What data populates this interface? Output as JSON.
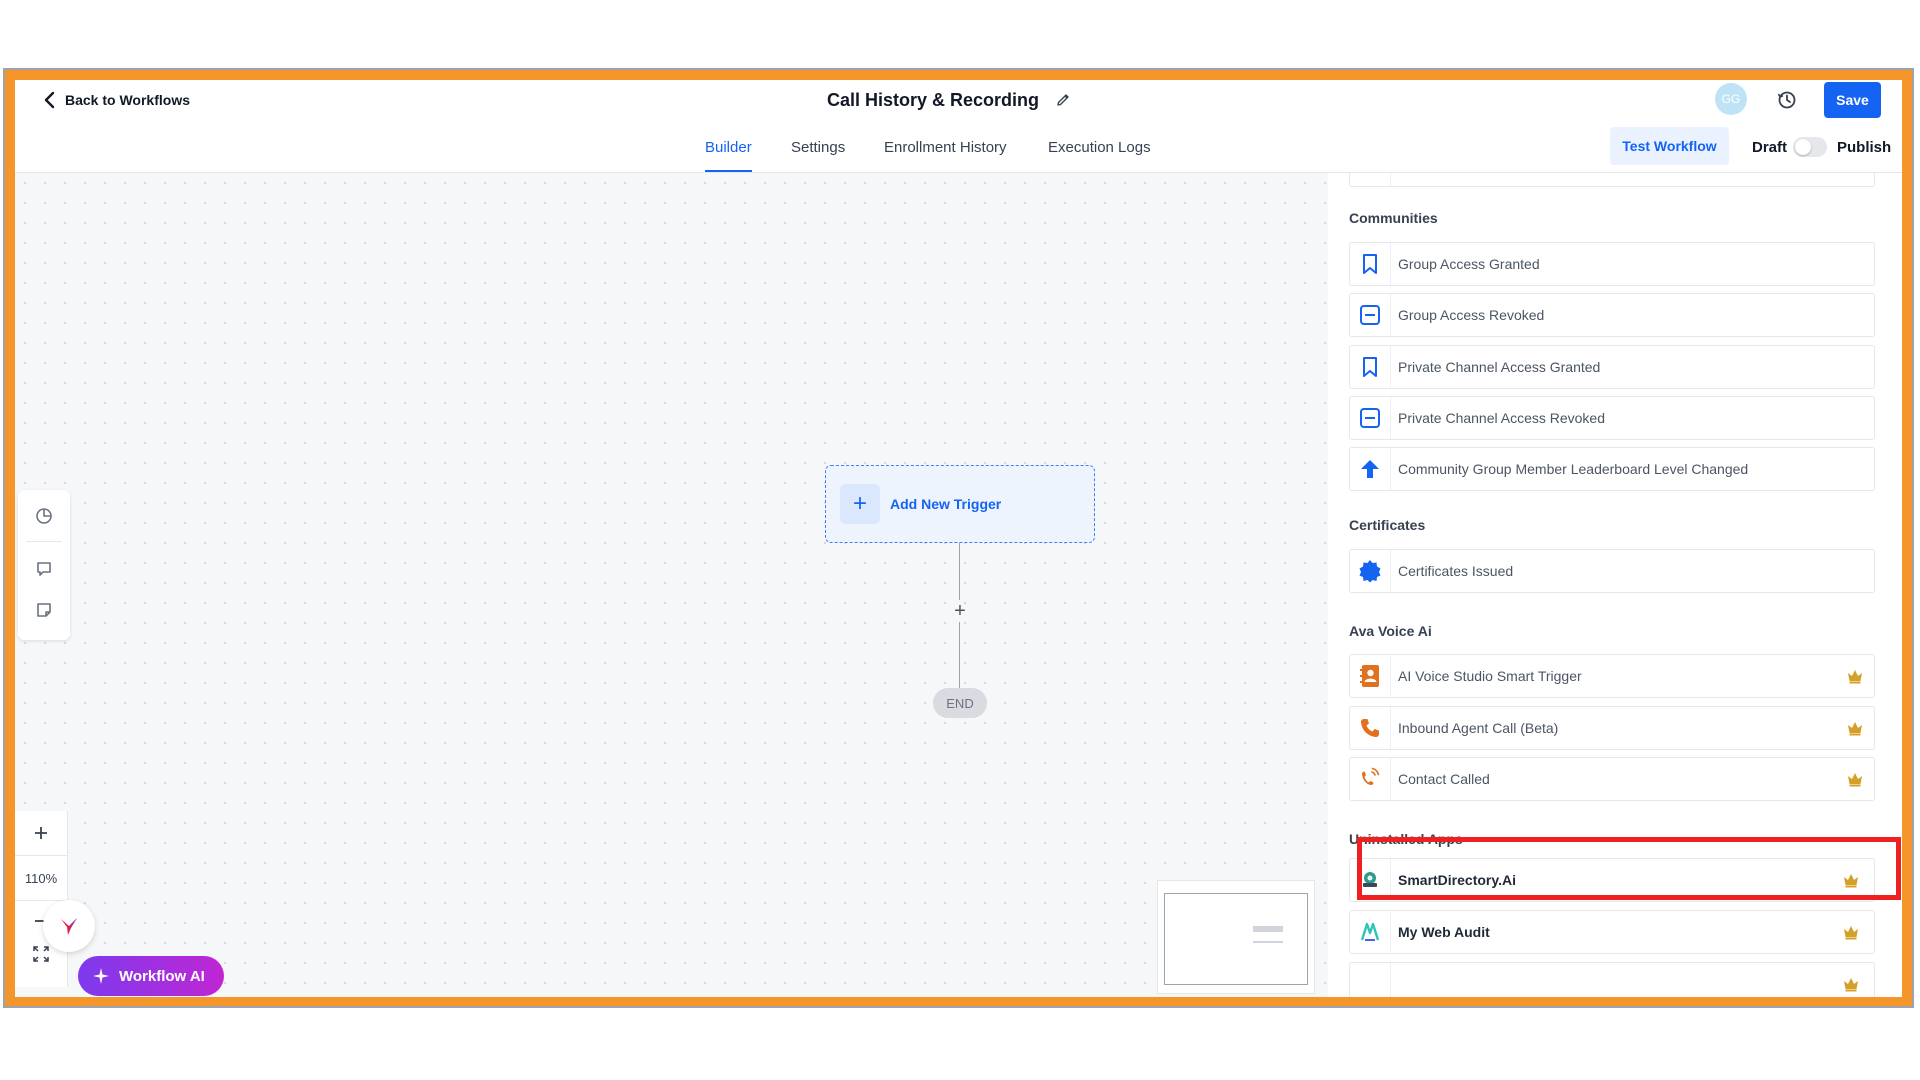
{
  "header": {
    "back_label": "Back to Workflows",
    "title": "Call History & Recording",
    "avatar_initials": "GG",
    "save_label": "Save"
  },
  "tabs": [
    "Builder",
    "Settings",
    "Enrollment History",
    "Execution Logs"
  ],
  "active_tab": "Builder",
  "toolbar": {
    "test_workflow_label": "Test Workflow",
    "draft_label": "Draft",
    "publish_label": "Publish",
    "publish_toggle_on": false
  },
  "canvas": {
    "trigger_label": "Add New Trigger",
    "end_label": "END",
    "zoom_level": "110%",
    "workflow_ai_label": "Workflow AI"
  },
  "panel": {
    "sections": [
      {
        "title": "Communities",
        "items": [
          {
            "label": "Group Access Granted",
            "icon": "bookmark-icon"
          },
          {
            "label": "Group Access Revoked",
            "icon": "minus-square-icon"
          },
          {
            "label": "Private Channel Access Granted",
            "icon": "bookmark-icon"
          },
          {
            "label": "Private Channel Access Revoked",
            "icon": "minus-square-icon"
          },
          {
            "label": "Community Group Member Leaderboard Level Changed",
            "icon": "arrow-up-icon"
          }
        ]
      },
      {
        "title": "Certificates",
        "items": [
          {
            "label": "Certificates Issued",
            "icon": "badge-icon"
          }
        ]
      },
      {
        "title": "Ava Voice Ai",
        "items": [
          {
            "label": "AI Voice Studio Smart Trigger",
            "icon": "contact-book-icon",
            "premium": true
          },
          {
            "label": "Inbound Agent Call (Beta)",
            "icon": "phone-icon",
            "premium": true
          },
          {
            "label": "Contact Called",
            "icon": "phone-ringing-icon",
            "premium": true,
            "highlighted": true
          }
        ]
      },
      {
        "title": "Uninstalled Apps",
        "items": [
          {
            "label": "SmartDirectory.Ai",
            "icon": "smartdirectory-logo-icon",
            "premium": true
          },
          {
            "label": "My Web Audit",
            "icon": "mywebaudit-logo-icon",
            "premium": true
          }
        ]
      }
    ]
  },
  "colors": {
    "accent": "#1463f3",
    "frame": "#f5962b",
    "highlight": "#ef2020",
    "crown": "#d4a02a",
    "ai_gradient_start": "#7c3aed",
    "ai_gradient_end": "#c026d3"
  }
}
